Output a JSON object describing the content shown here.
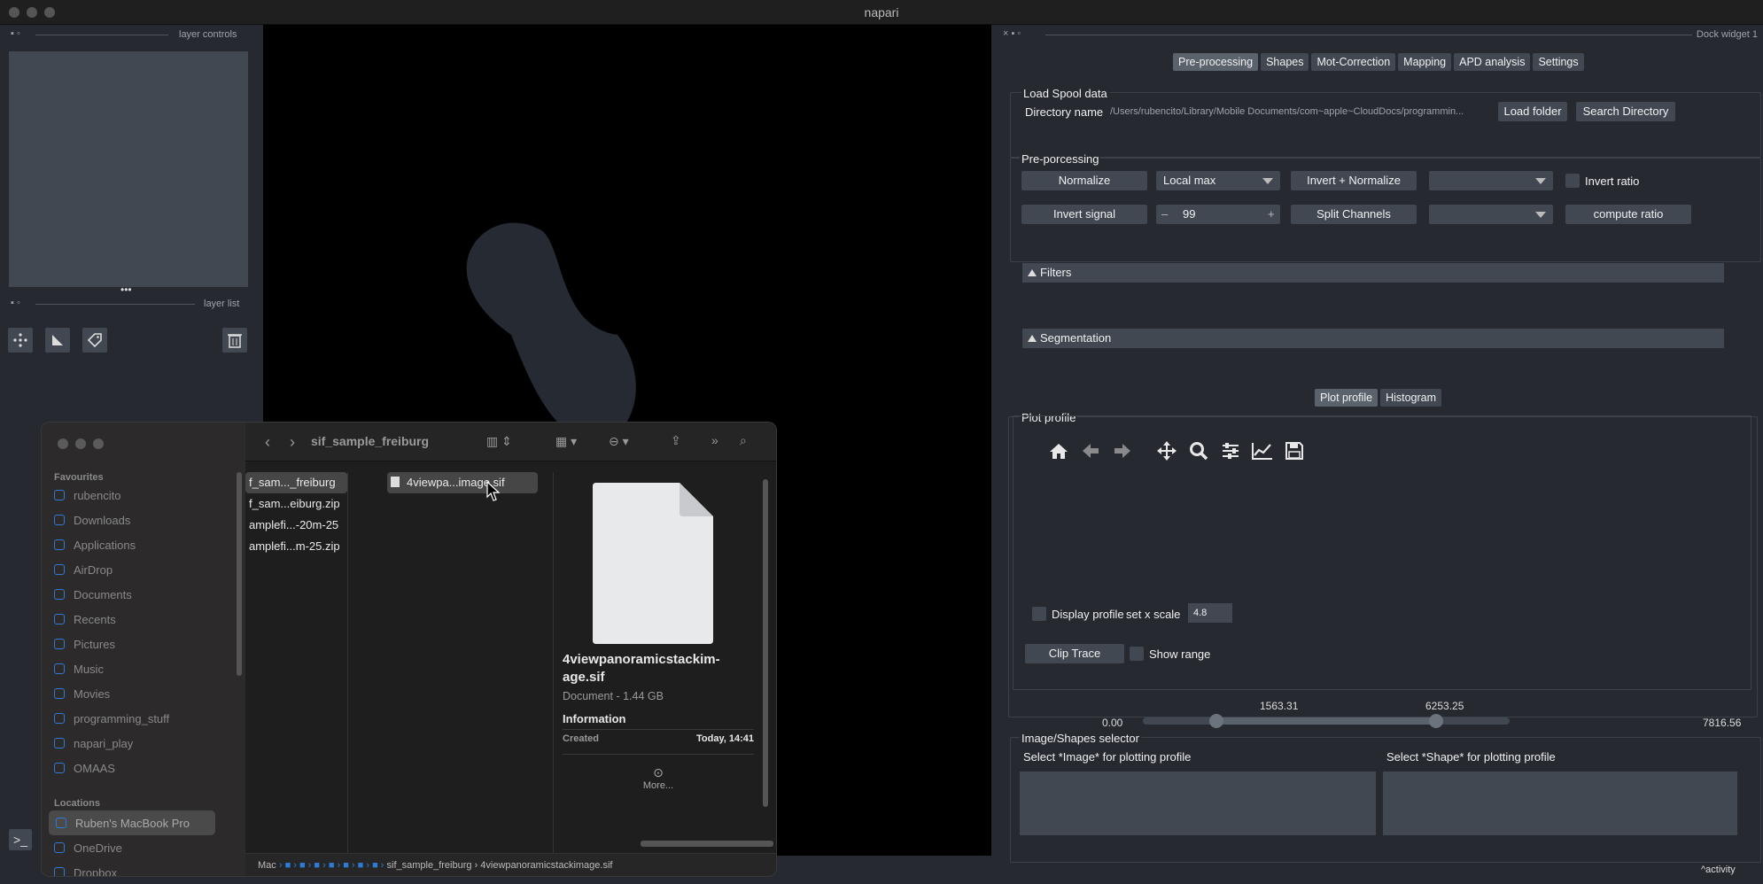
{
  "window": {
    "title": "napari"
  },
  "left": {
    "layer_controls_label": "layer controls",
    "layer_list_label": "layer list",
    "handle": "•••"
  },
  "dock": {
    "title": "Dock widget 1"
  },
  "tabs": [
    "Pre-processing",
    "Shapes",
    "Mot-Correction",
    "Mapping",
    "APD analysis",
    "Settings"
  ],
  "spool": {
    "group": "Load Spool data",
    "dir_label": "Directory name",
    "dir_value": "/Users/rubencito/Library/Mobile Documents/com~apple~CloudDocs/programmin...",
    "load_btn": "Load folder",
    "search_btn": "Search Directory"
  },
  "preproc": {
    "group": "Pre-porcessing",
    "normalize": "Normalize",
    "local_max": "Local max",
    "invert_normalize": "Invert + Normalize",
    "invert_ratio": "Invert ratio",
    "invert_signal": "Invert signal",
    "spin_minus": "–",
    "spin_value": "99",
    "spin_plus": "+",
    "split_channels": "Split Channels",
    "compute_ratio": "compute ratio"
  },
  "filters": {
    "label": "Filters"
  },
  "segmentation": {
    "label": "Segmentation"
  },
  "plot_tabs": [
    "Plot profile",
    "Histogram"
  ],
  "plot": {
    "group": "Plot profile",
    "display_profile": "Display profile",
    "set_x_scale": "set x scale",
    "x_scale": "4.8",
    "clip_trace": "Clip Trace",
    "show_range": "Show range",
    "range_min": "0.00",
    "range_max": "7816.56",
    "low": "1563.31",
    "high": "6253.25",
    "low_value": 1563.31,
    "high_value": 6253.25,
    "min_value": 0.0,
    "max_value": 7816.56
  },
  "selector": {
    "group": "Image/Shapes selector",
    "image_label": "Select *Image* for plotting profile",
    "shape_label": "Select *Shape* for plotting profile"
  },
  "activity": "activity",
  "finder": {
    "title": "sif_sample_freiburg",
    "favourites_head": "Favourites",
    "favourites": [
      "rubencito",
      "Downloads",
      "Applications",
      "AirDrop",
      "Documents",
      "Recents",
      "Pictures",
      "Music",
      "Movies",
      "programming_stuff",
      "napari_play",
      "OMAAS"
    ],
    "locations_head": "Locations",
    "locations": [
      "Ruben's MacBook Pro",
      "OneDrive",
      "Dropbox"
    ],
    "col1": [
      "f_sam..._freiburg",
      "f_sam...eiburg.zip",
      "amplefi...-20m-25",
      "amplefi...m-25.zip"
    ],
    "col2": [
      "4viewpa...image.sif"
    ],
    "preview_name": "4viewpanoramicstackim-age.sif",
    "preview_kind": "Document - 1.44 GB",
    "info_head": "Information",
    "created_label": "Created",
    "created_value": "Today, 14:41",
    "more": "More...",
    "path": [
      "Mac",
      "sif_sample_freiburg",
      "4viewpanoramicstackimage.sif"
    ]
  }
}
